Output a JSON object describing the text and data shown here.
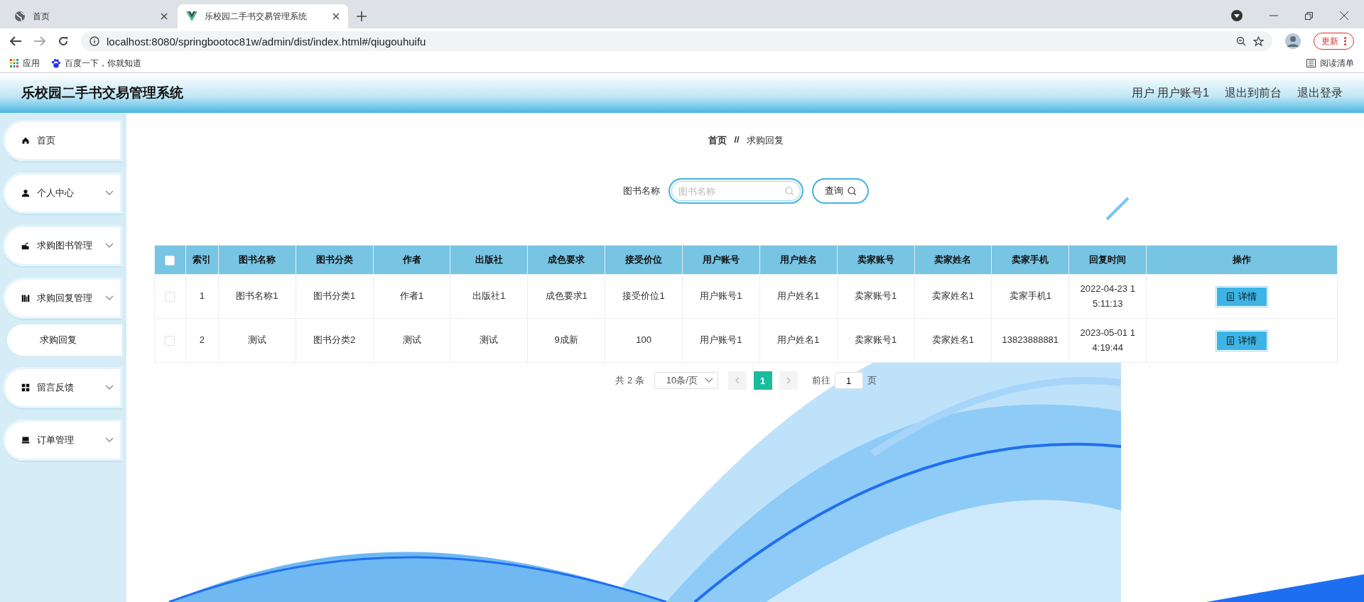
{
  "browser": {
    "tabs": [
      {
        "label": "首页",
        "selected": false
      },
      {
        "label": "乐校园二手书交易管理系统",
        "selected": true
      }
    ],
    "url": "localhost:8080/springbootoc81w/admin/dist/index.html#/qiugouhuifu",
    "update_button": "更新",
    "bookmarks": [
      "应用",
      "百度一下，你就知道"
    ],
    "reading_list": "阅读清单"
  },
  "header": {
    "title": "乐校园二手书交易管理系统",
    "user": "用户 用户账号1",
    "links": [
      "退出到前台",
      "退出登录"
    ]
  },
  "sidebar": {
    "items": [
      {
        "label": "首页",
        "kind": "link"
      },
      {
        "label": "个人中心",
        "kind": "submenu"
      },
      {
        "label": "求购图书管理",
        "kind": "submenu"
      },
      {
        "label": "求购回复管理",
        "kind": "submenu",
        "children": [
          {
            "label": "求购回复"
          }
        ]
      },
      {
        "label": "留言反馈",
        "kind": "submenu"
      },
      {
        "label": "订单管理",
        "kind": "submenu"
      }
    ]
  },
  "breadcrumb": [
    "首页",
    "求购回复"
  ],
  "breadcrumb_separator": "//",
  "search": {
    "label": "图书名称",
    "placeholder": "图书名称",
    "button": "查询"
  },
  "table": {
    "all_checked": false,
    "columns": [
      "索引",
      "图书名称",
      "图书分类",
      "作者",
      "出版社",
      "成色要求",
      "接受价位",
      "用户账号",
      "用户姓名",
      "卖家账号",
      "卖家姓名",
      "卖家手机",
      "回复时间",
      "操作"
    ],
    "rows": [
      {
        "checked": false,
        "cells": [
          "1",
          "图书名称1",
          "图书分类1",
          "作者1",
          "出版社1",
          "成色要求1",
          "接受价位1",
          "用户账号1",
          "用户姓名1",
          "卖家账号1",
          "卖家姓名1",
          "卖家手机1",
          "2022-04-23 1\n5:11:13"
        ],
        "action": "详情"
      },
      {
        "checked": false,
        "cells": [
          "2",
          "测试",
          "图书分类2",
          "测试",
          "测试",
          "9成新",
          "100",
          "用户账号1",
          "用户姓名1",
          "卖家账号1",
          "卖家姓名1",
          "13823888881",
          "2023-05-01 1\n4:19:44"
        ],
        "action": "详情"
      }
    ]
  },
  "pagination": {
    "total": "共 2 条",
    "page_size": "10条/页",
    "pages": [
      {
        "label": "1",
        "selected": true
      }
    ],
    "goto": "前往",
    "goto_value": "1",
    "goto_suffix": "页"
  }
}
